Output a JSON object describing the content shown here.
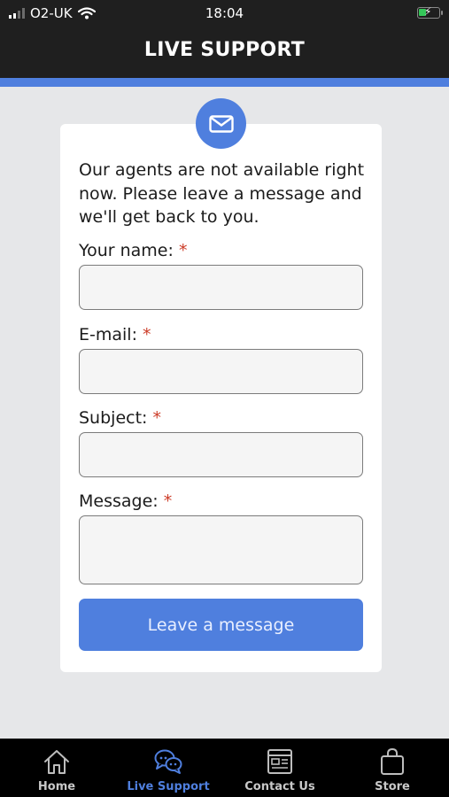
{
  "status_bar": {
    "carrier": "O2-UK",
    "time": "18:04"
  },
  "header": {
    "title": "LIVE SUPPORT"
  },
  "form": {
    "intro": "Our agents are not available right now. Please leave a message and we'll get back to you.",
    "required_marker": "*",
    "fields": [
      {
        "label": "Your name:",
        "value": ""
      },
      {
        "label": "E-mail:",
        "value": ""
      },
      {
        "label": "Subject:",
        "value": ""
      },
      {
        "label": "Message:",
        "value": ""
      }
    ],
    "submit_label": "Leave a message"
  },
  "tab_bar": {
    "tabs": [
      {
        "label": "Home",
        "icon": "home-icon",
        "active": false
      },
      {
        "label": "Live Support",
        "icon": "chat-bubbles-icon",
        "active": true
      },
      {
        "label": "Contact Us",
        "icon": "newspaper-icon",
        "active": false
      },
      {
        "label": "Store",
        "icon": "shopping-bag-icon",
        "active": false
      }
    ]
  },
  "colors": {
    "accent": "#4f7fde",
    "header_bg": "#1f1f1f",
    "required": "#cc3b27",
    "battery_charging": "#35c759"
  }
}
